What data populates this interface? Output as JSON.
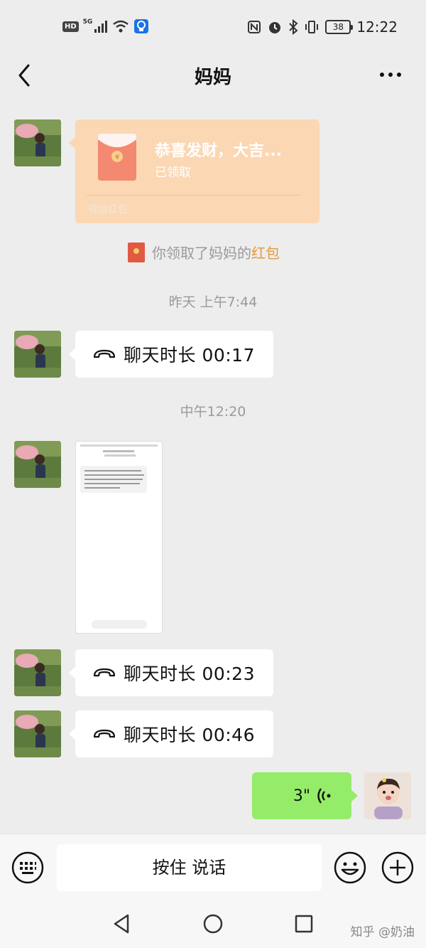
{
  "status_bar": {
    "left_badge": "HD",
    "network": "5G",
    "battery": "38",
    "time": "12:22"
  },
  "header": {
    "title": "妈妈"
  },
  "messages": {
    "red_packet": {
      "title": "恭喜发财，大吉...",
      "status": "已领取",
      "brand": "微信红包"
    },
    "red_packet_notice": {
      "text": "你领取了妈妈的",
      "link": "红包"
    },
    "time_1": "昨天 上午7:44",
    "call_1": "聊天时长 00:17",
    "time_2": "中午12:20",
    "call_2": "聊天时长 00:23",
    "call_3": "聊天时长 00:46",
    "voice": {
      "duration": "3\""
    }
  },
  "input_bar": {
    "hold_to_talk": "按住 说话"
  },
  "watermark": "知乎 @奶油",
  "colors": {
    "background": "#ededed",
    "my_bubble": "#95ec69",
    "red_packet": "#fbd7b4",
    "link_orange": "#e69a36"
  }
}
